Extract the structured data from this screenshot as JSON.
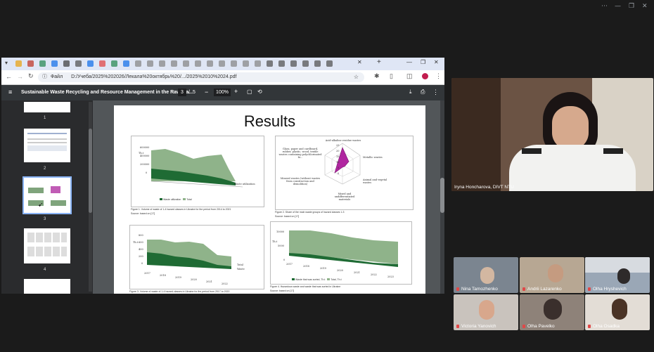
{
  "meeting": {
    "window_controls": [
      "⋯",
      "—",
      "❐",
      "✕"
    ]
  },
  "browser": {
    "url_chip": "Файл",
    "url": "D:/Учеба/2025%202026/Лекала%20октябрь%20/.../2025%2010%2024.pdf",
    "new_tab": "+"
  },
  "pdf": {
    "title": "Sustainable Waste Recycling and Resource Management in the Raw Ma...",
    "page_current": "3",
    "page_sep": "/",
    "page_total": "5",
    "zoom": "100%",
    "thumbnails": [
      "1",
      "2",
      "3",
      "4"
    ],
    "slide_title": "Results",
    "fig1": {
      "y_ticks": [
        "600000",
        "400000",
        "200000",
        "0"
      ],
      "ylabel": "Th.t",
      "series_label": "Waste utilization",
      "legend": [
        "Waste utilization",
        "Total"
      ],
      "caption": "Figure 1. Volume of waste of 1-4 hazard classes in Ukraine for the period from 2014 to 2021",
      "source": "Source: based on [17]"
    },
    "fig2": {
      "labels": [
        "Acid-alkaline residue wastes",
        "Metallic wastes",
        "Animal and vegetal wastes",
        "Mixed and undifferentiated materials",
        "Mineral wastes (without wastes from construction and demolition)",
        "Glass, paper and cardboard, rubber, plastic, wood, textile wastes containing polychlorinated bi..."
      ],
      "ticks": [
        "25",
        "20",
        "15",
        "10",
        "5",
        "0"
      ],
      "caption": "Figure 2. Share of the main waste groups of hazard classes 1-3",
      "source": "Source: based on [17]"
    },
    "fig3": {
      "y_ticks": [
        "800",
        "600",
        "400",
        "200",
        "0"
      ],
      "ylabel": "Th.t",
      "years": [
        "2017",
        "2018",
        "2019",
        "2020",
        "2021",
        "2022"
      ],
      "series_labels": [
        "Total",
        "Waste"
      ],
      "legend": [
        "Waste utilization",
        "Total"
      ],
      "caption": "Figure 3. Volume of waste of 1-4 hazard classes in Ukraine for the period from 2017 to 2022"
    },
    "fig4": {
      "y_ticks": [
        "10000",
        "5000",
        "0"
      ],
      "ylabel": "Th.t",
      "years": [
        "2017",
        "2018",
        "2019",
        "2020",
        "2021",
        "2022",
        "2023"
      ],
      "legend": [
        "Waste that was sorted, Th.t",
        "Total, Th.t"
      ],
      "caption": "Figure 4. Hazardous waste and waste that was sorted in Ukraine",
      "source": "Source: based on [17]"
    }
  },
  "participants": {
    "presenter": "Iryna Honcharova, DIVT NTU",
    "grid": [
      {
        "name": "Nina Tamozhenko"
      },
      {
        "name": "Andrii Lazarenko"
      },
      {
        "name": "Olha Hryshevich"
      },
      {
        "name": "Victoria Yanovich"
      },
      {
        "name": "Olha Pavelko"
      },
      {
        "name": "Olha Osadka"
      }
    ]
  },
  "colors": {
    "accent_green": "#1f6b34",
    "light_green": "#8fb38a",
    "radar_fill": "#b026a0",
    "pdf_toolbar": "#323639",
    "tab_bar": "#dfe6f5"
  }
}
